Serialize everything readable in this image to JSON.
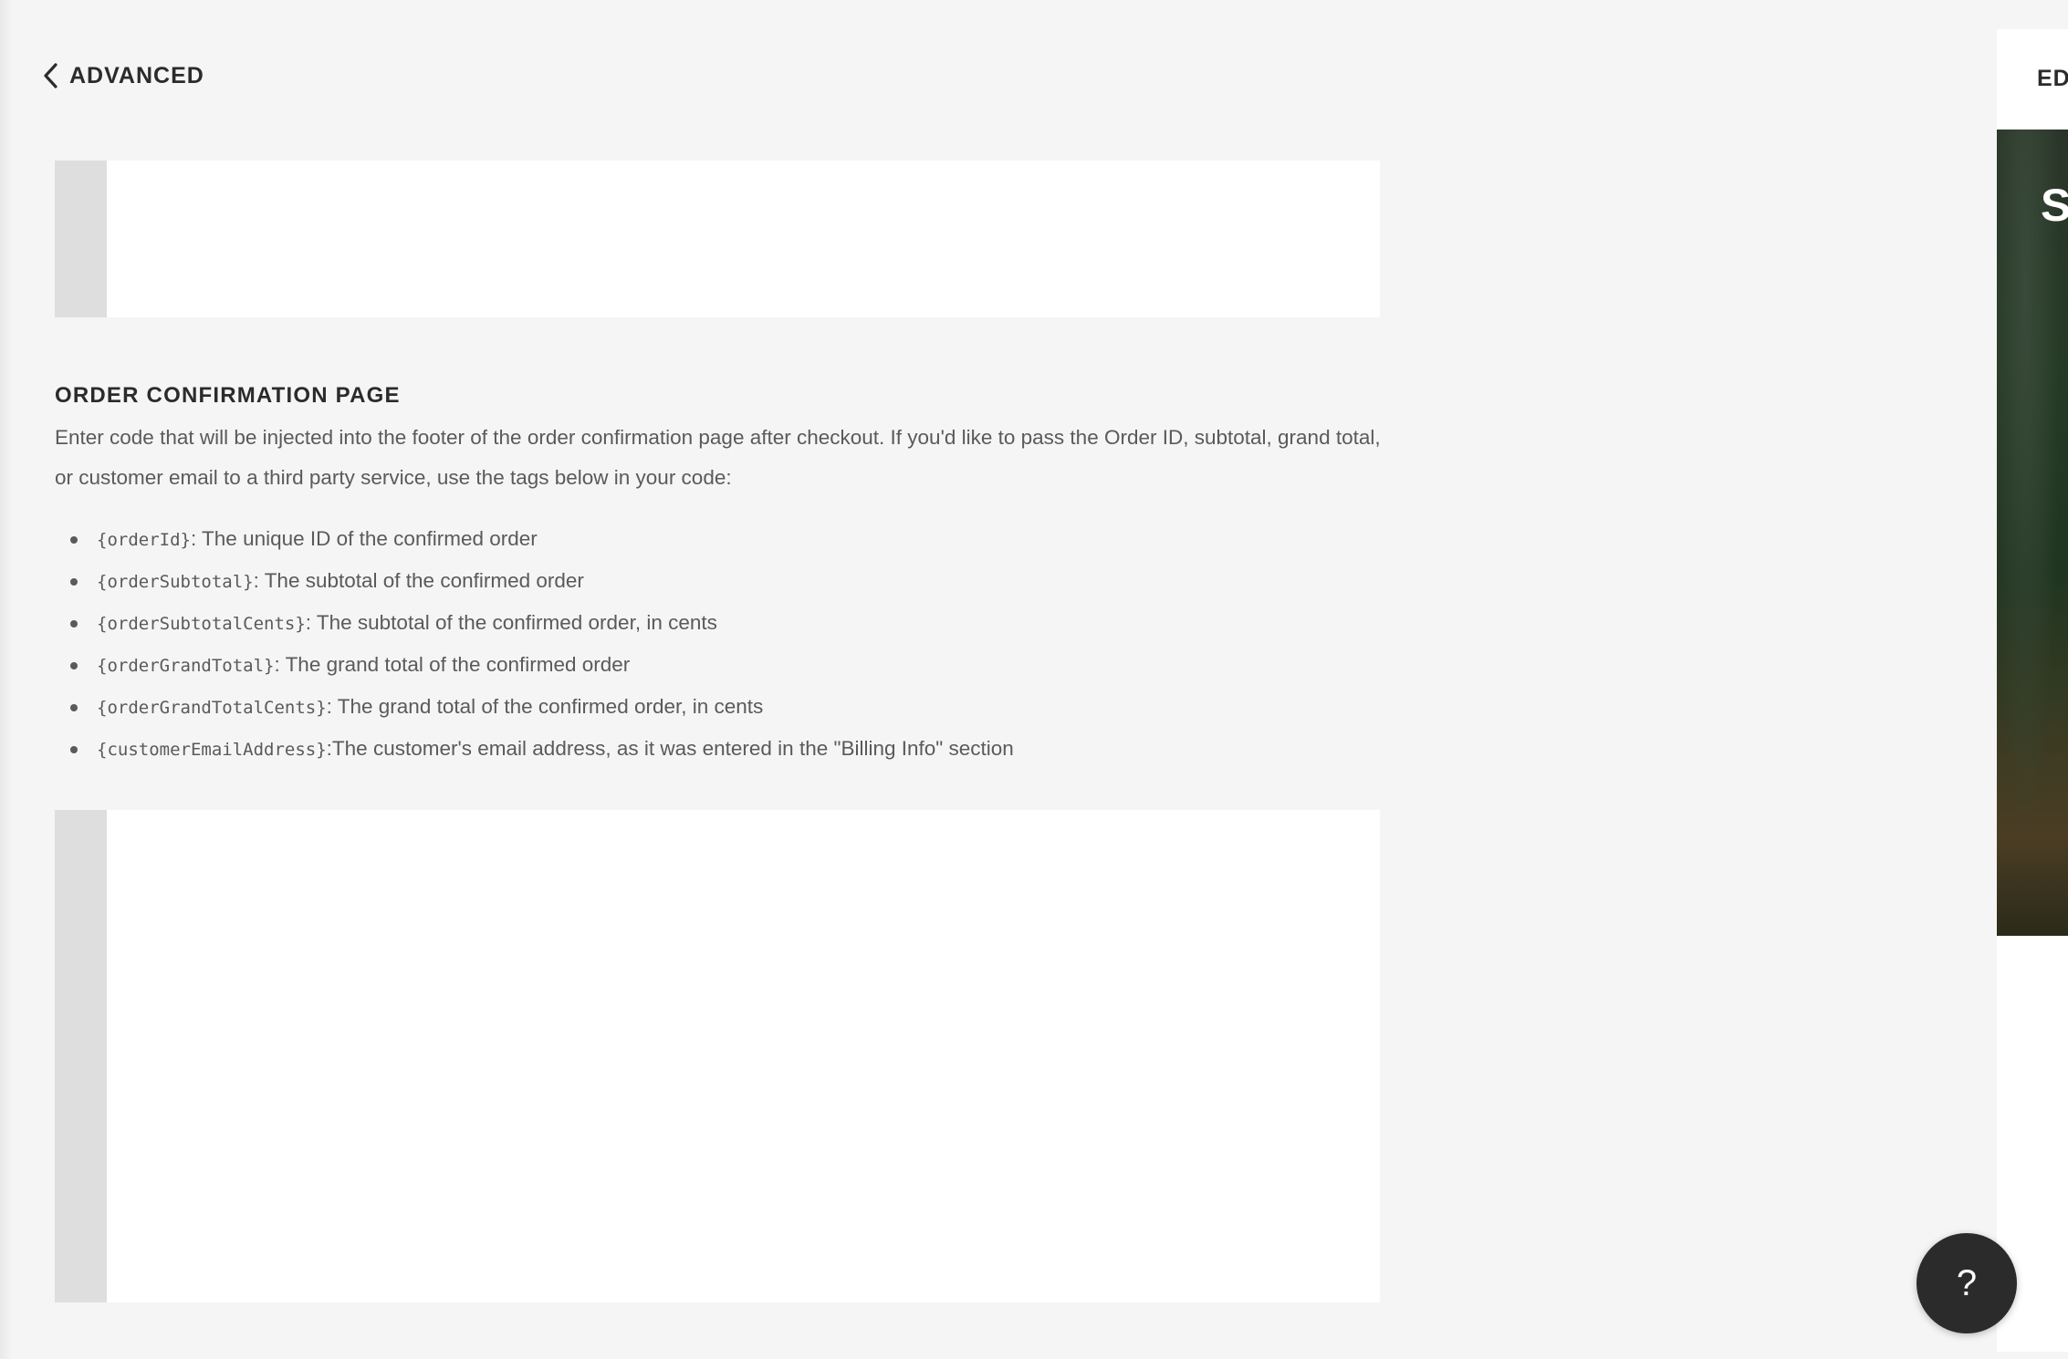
{
  "header": {
    "back_label": "ADVANCED"
  },
  "order_confirmation": {
    "title": "ORDER CONFIRMATION PAGE",
    "description": "Enter code that will be injected into the footer of the order confirmation page after checkout. If you'd like to pass the Order ID, subtotal, grand total, or customer email to a third party service, use the tags below in your code:",
    "tags": [
      {
        "code": "{orderId}",
        "text": ": The unique ID of the confirmed order"
      },
      {
        "code": "{orderSubtotal}",
        "text": ": The subtotal of the confirmed order"
      },
      {
        "code": "{orderSubtotalCents}",
        "text": ": The subtotal of the confirmed order, in cents"
      },
      {
        "code": "{orderGrandTotal}",
        "text": ": The grand total of the confirmed order"
      },
      {
        "code": "{orderGrandTotalCents}",
        "text": ": The grand total of the confirmed order, in cents"
      },
      {
        "code": "{customerEmailAddress}",
        "text": ":The customer's email address, as it was entered in the \"Billing Info\" section"
      }
    ]
  },
  "editors": {
    "top_value": "",
    "bottom_value": ""
  },
  "preview": {
    "label": "ED",
    "heading": "S"
  },
  "help": {
    "label": "?"
  }
}
